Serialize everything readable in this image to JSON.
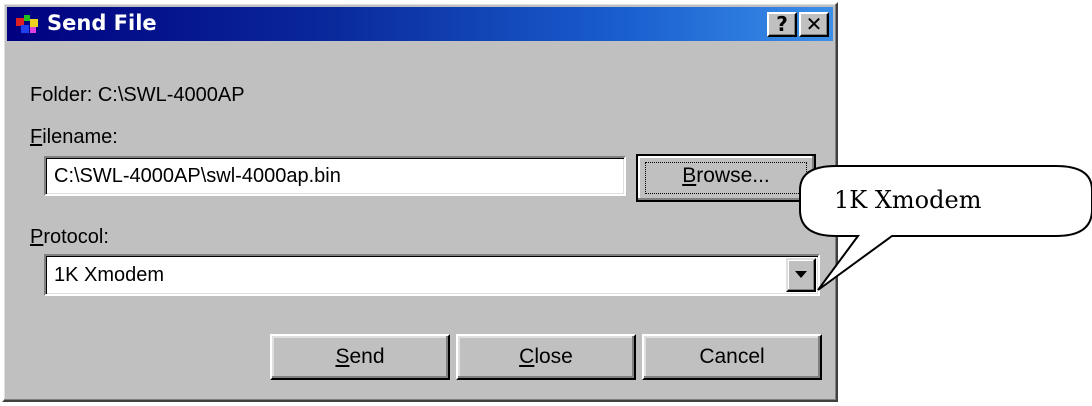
{
  "window": {
    "title": "Send File",
    "help_button": "?",
    "close_button": "✕"
  },
  "folder": {
    "label": "Folder:",
    "value": "C:\\SWL-4000AP"
  },
  "filename": {
    "label_accel": "F",
    "label_rest": "ilename:",
    "value": "C:\\SWL-4000AP\\swl-4000ap.bin",
    "browse_accel": "B",
    "browse_rest": "rowse..."
  },
  "protocol": {
    "label_accel": "P",
    "label_rest": "rotocol:",
    "selected": "1K Xmodem"
  },
  "buttons": {
    "send_accel": "S",
    "send_rest": "end",
    "close_accel": "C",
    "close_rest": "lose",
    "cancel": "Cancel"
  },
  "callout": {
    "text": "1K Xmodem"
  },
  "colors": {
    "dialog_face": "#c0c0c0",
    "title_start": "#000080",
    "title_end": "#3b8fe8"
  },
  "icons": {
    "app_icon": "send-file-app-icon",
    "dropdown": "chevron-down-icon"
  }
}
